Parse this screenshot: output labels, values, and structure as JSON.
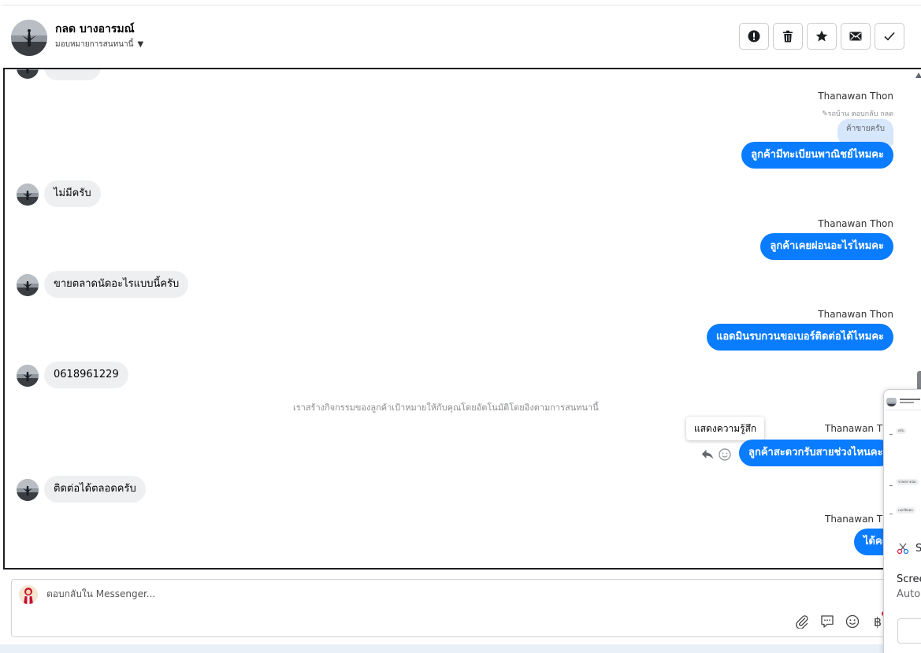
{
  "header": {
    "contact_name": "กลด บางอารมณ์",
    "assign_label": "มอบหมายการสนทนานี้"
  },
  "messages": {
    "partial_top": "ไม่มีครับ",
    "m1": {
      "sender": "Thanawan Thon",
      "reply_note": "รถบ้าน ตอบกลับ กลด",
      "quote": "ค้าขายครับ",
      "text": "ลูกค้ามีทะเบียนพาณิชย์ไหมคะ"
    },
    "in1": "ไม่มีครับ",
    "m2": {
      "sender": "Thanawan Thon",
      "text": "ลูกค้าเคยผ่อนอะไรไหมคะ"
    },
    "in2": "ขายตลาดนัดอะไรแบบนี้ครับ",
    "m3": {
      "sender": "Thanawan Thon",
      "text": "แอดมินรบกวนขอเบอร์ติดต่อได้ไหมคะ"
    },
    "in3": "0618961229",
    "system_note": "เราสร้างกิจกรรมของลูกค้าเป้าหมายให้กับคุณโดยอัตโนมัติโดยอิงตามการสนทนานี้",
    "tooltip": "แสดงความรู้สึก",
    "m4": {
      "sender": "Thanawan Thon",
      "text": "ลูกค้าสะดวกรับสายช่วงไหนคะ"
    },
    "in4": "ติดต่อได้ตลอดครับ",
    "m5": {
      "sender": "Thanawan Thon",
      "text": "ได้คะ"
    }
  },
  "composer": {
    "placeholder": "ตอบกลับใน Messenger..."
  },
  "mini_window": {
    "line1": "S",
    "line2": "Scree",
    "line3": "Auto",
    "bubbles": [
      "ครับ",
      "ขายตลาดนัด",
      "เบอร์ติดต่อ"
    ]
  },
  "colors": {
    "outgoing_bubble": "#0a7cff",
    "incoming_bubble": "#eeeff1"
  }
}
